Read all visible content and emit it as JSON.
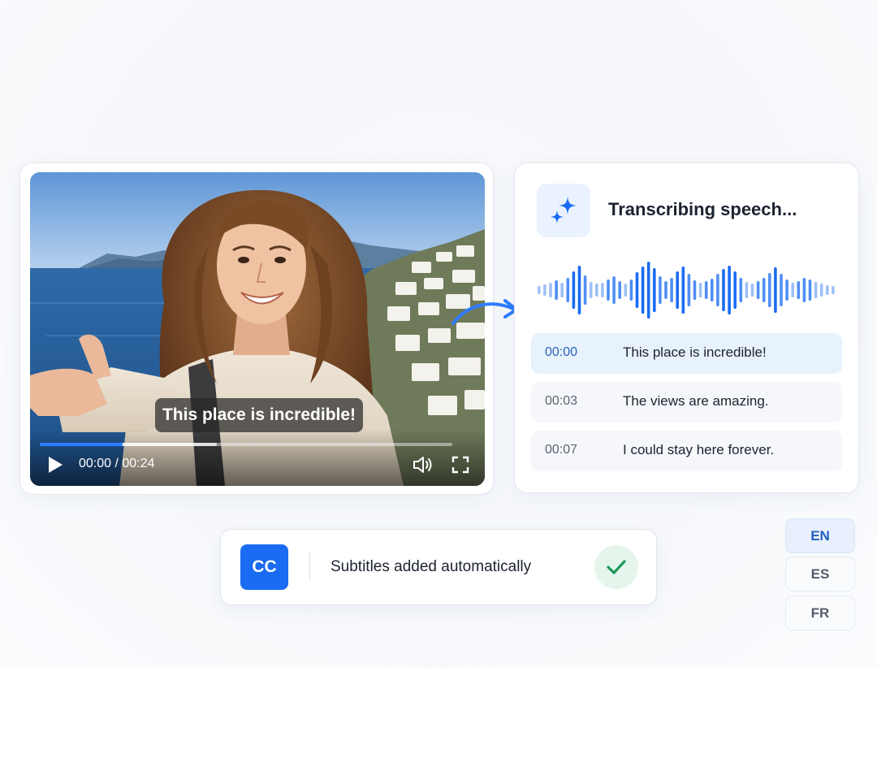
{
  "video": {
    "subtitle": "This place is incredible!",
    "current_time": "00:00",
    "duration": "00:24",
    "time_display": "00:00 / 00:24",
    "progress_fraction": 0.2,
    "buffer_fraction": 0.43
  },
  "transcript": {
    "title": "Transcribing speech...",
    "rows": [
      {
        "time": "00:00",
        "text": "This place is incredible!",
        "active": true
      },
      {
        "time": "00:03",
        "text": "The views are amazing.",
        "active": false
      },
      {
        "time": "00:07",
        "text": "I could stay here forever.",
        "active": false
      }
    ]
  },
  "banner": {
    "cc_label": "CC",
    "message": "Subtitles added automatically"
  },
  "languages": [
    {
      "code": "EN",
      "active": true
    },
    {
      "code": "ES",
      "active": false
    },
    {
      "code": "FR",
      "active": false
    }
  ],
  "icons": {
    "transcribe": "sparkle-icon",
    "play": "play-icon",
    "volume": "volume-icon",
    "fullscreen": "fullscreen-icon",
    "status": "check-icon",
    "flow": "curved-arrow-icon"
  },
  "colors": {
    "accent": "#1a6cf2",
    "progress": "#2f7bff",
    "success": "#1f9a5a",
    "active_row": "#e8f2fd"
  }
}
